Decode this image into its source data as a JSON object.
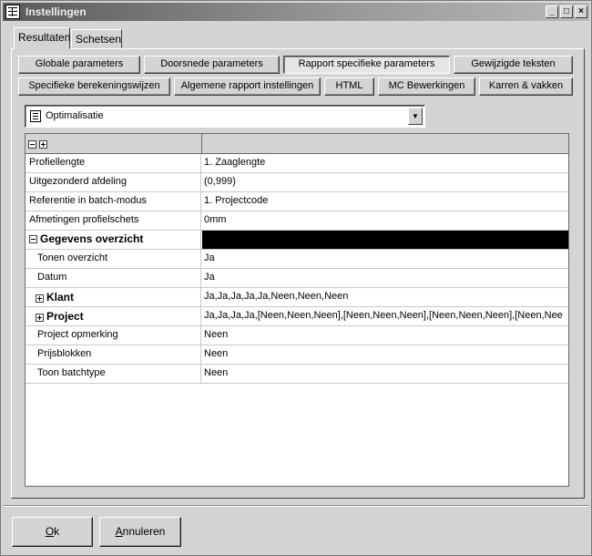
{
  "window": {
    "title": "Instellingen"
  },
  "tabs": [
    {
      "label": "Resultaten",
      "active": true
    },
    {
      "label": "Schetsen",
      "active": false
    }
  ],
  "buttons_row1": [
    {
      "label": "Globale parameters"
    },
    {
      "label": "Doorsnede parameters"
    },
    {
      "label": "Rapport specifieke parameters",
      "pressed": true
    },
    {
      "label": "Gewijzigde teksten"
    }
  ],
  "buttons_row2": [
    {
      "label": "Specifieke berekeningswijzen"
    },
    {
      "label": "Algemene rapport instellingen"
    },
    {
      "label": "HTML"
    },
    {
      "label": "MC Bewerkingen"
    },
    {
      "label": "Karren & vakken"
    }
  ],
  "combo": {
    "value": "Optimalisatie",
    "icon": "report-icon"
  },
  "grid": {
    "rows": [
      {
        "key": "Profiellengte",
        "value": "1. Zaaglengte"
      },
      {
        "key": "Uitgezonderd afdeling",
        "value": "(0,999)"
      },
      {
        "key": "Referentie in batch-modus",
        "value": "1. Projectcode"
      },
      {
        "key": "Afmetingen profielschets",
        "value": "0mm"
      },
      {
        "key": "Gegevens overzicht",
        "value": ""
      },
      {
        "key": "Tonen overzicht",
        "value": "Ja"
      },
      {
        "key": "Datum",
        "value": "Ja"
      },
      {
        "key": "Klant",
        "value": "Ja,Ja,Ja,Ja,Ja,Neen,Neen,Neen"
      },
      {
        "key": "Project",
        "value": "Ja,Ja,Ja,Ja,[Neen,Neen,Neen],[Neen,Neen,Neen],[Neen,Neen,Neen],[Neen,Nee"
      },
      {
        "key": "Project opmerking",
        "value": "Neen"
      },
      {
        "key": "Prijsblokken",
        "value": "Neen"
      },
      {
        "key": "Toon batchtype",
        "value": "Neen"
      }
    ]
  },
  "footer": {
    "ok": {
      "mnemonic": "O",
      "rest": "k"
    },
    "cancel": {
      "mnemonic": "A",
      "rest": "nnuleren"
    }
  }
}
